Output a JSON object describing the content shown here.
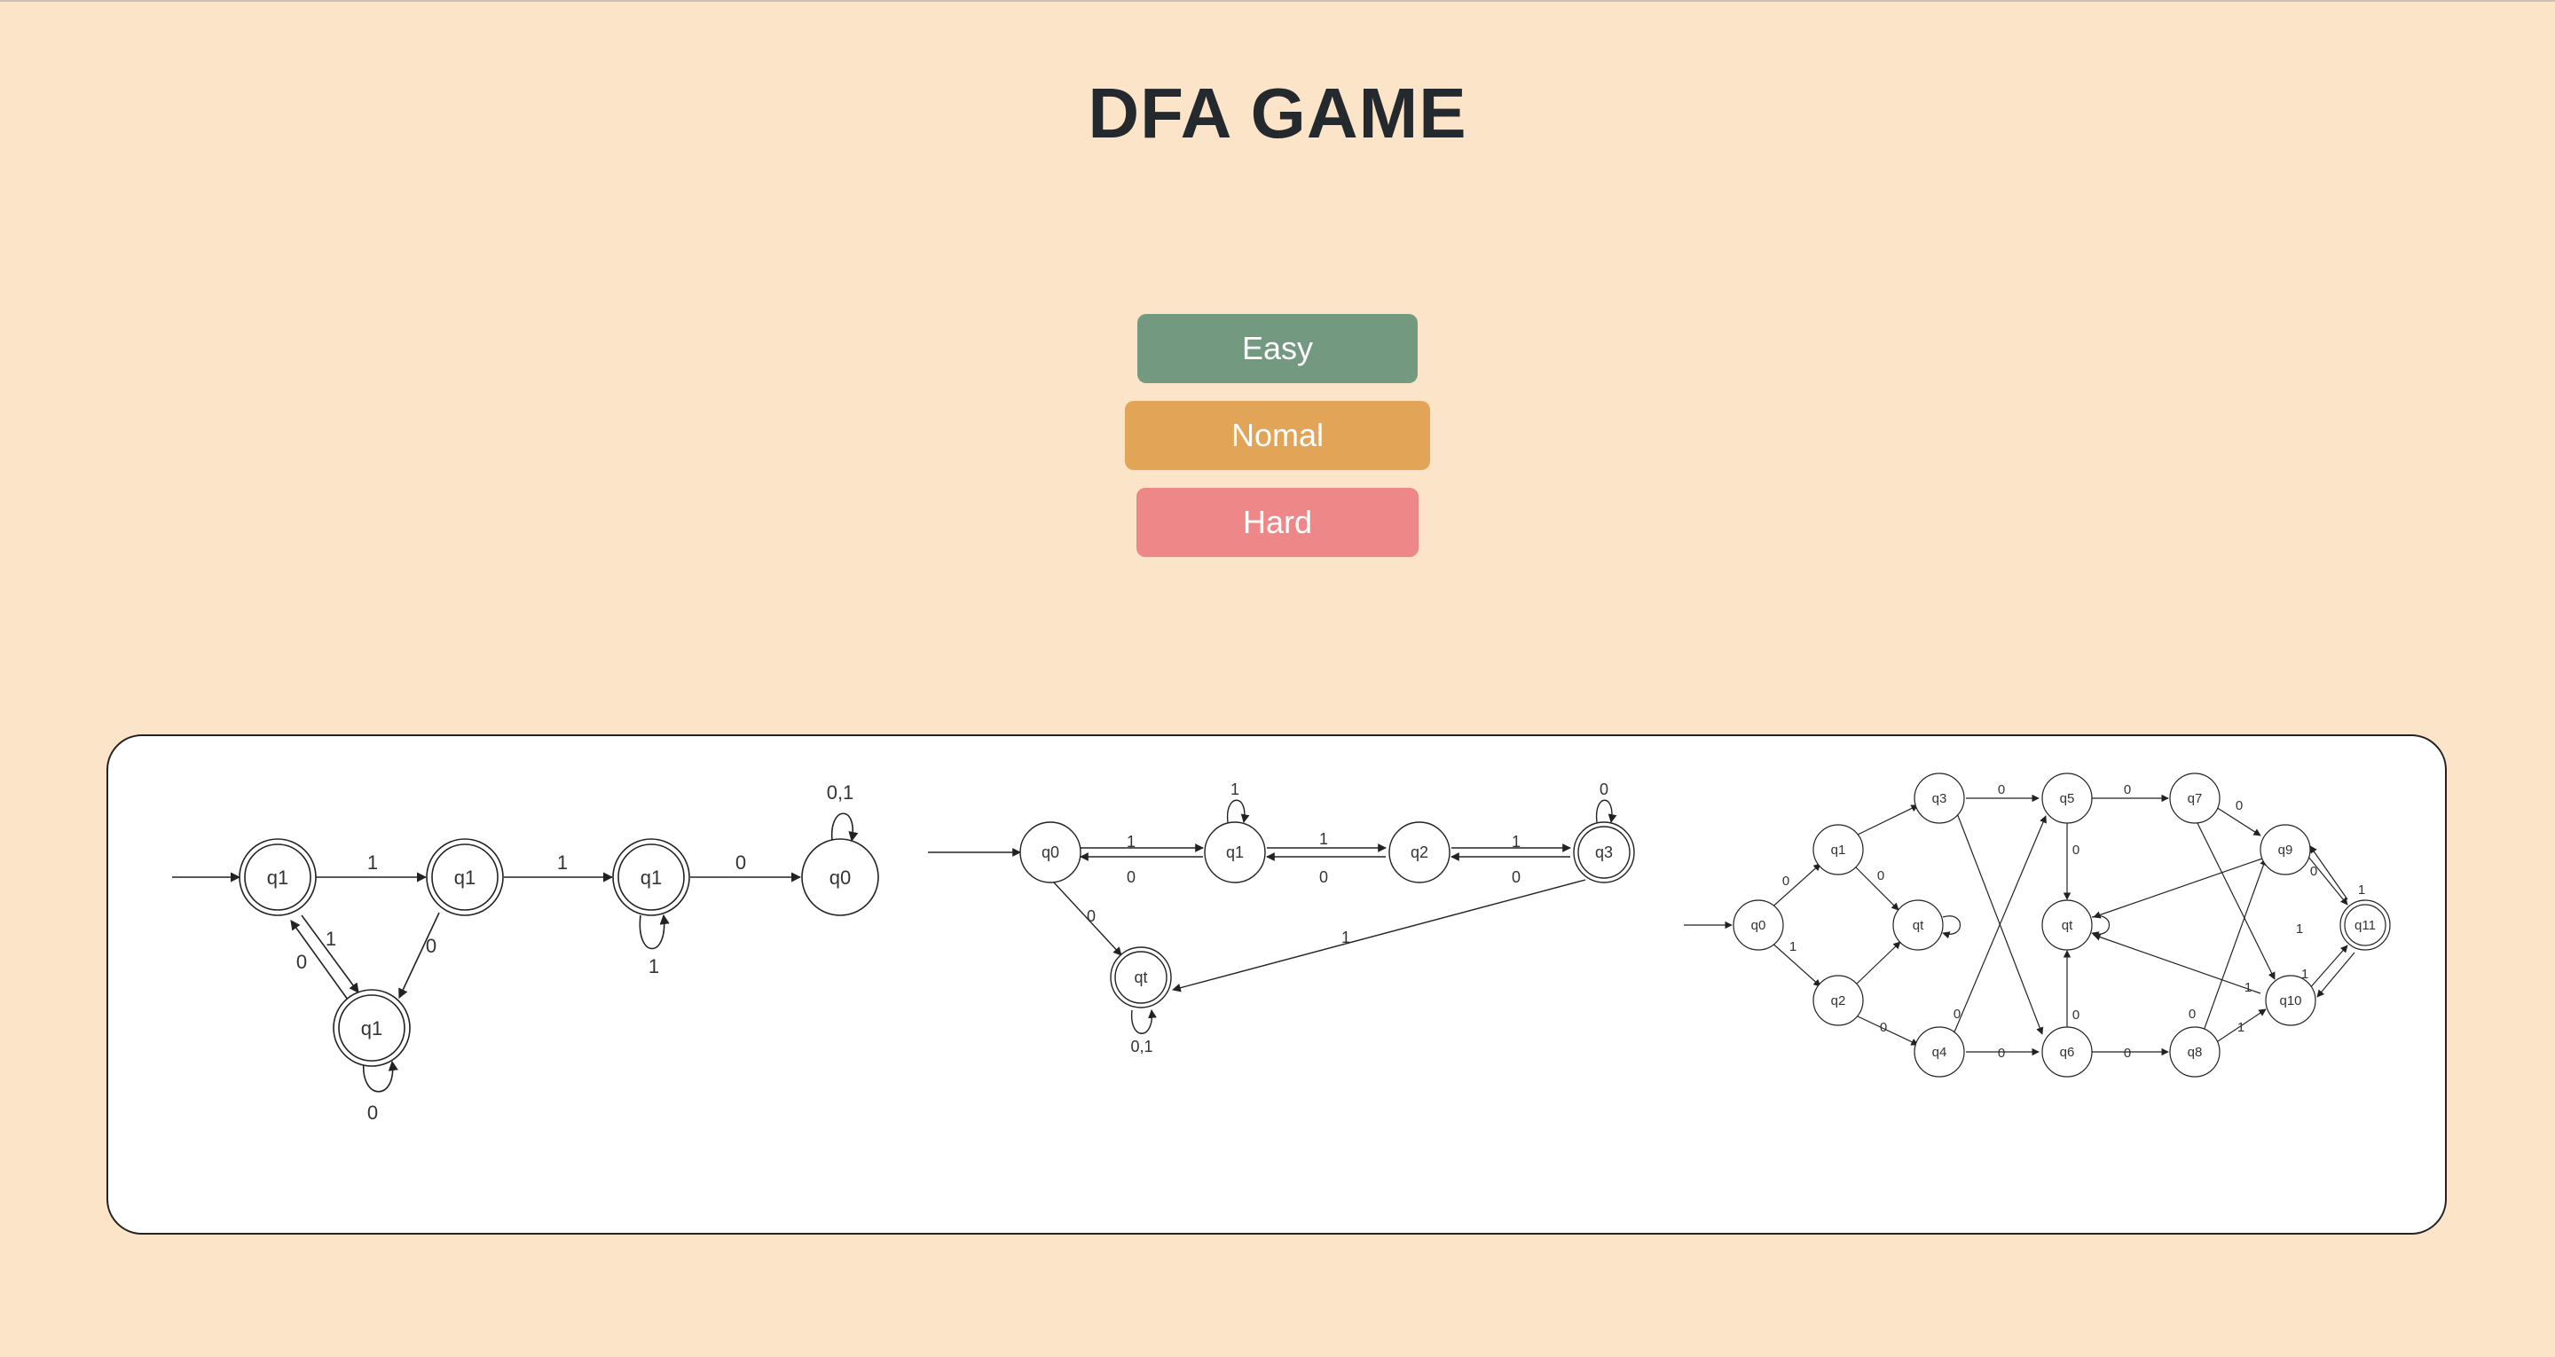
{
  "page": {
    "title": "DFA GAME",
    "background": "#fbe4c8"
  },
  "difficulty": {
    "easy": {
      "label": "Easy",
      "color": "#739a80"
    },
    "normal": {
      "label": "Nomal",
      "color": "#e2a456"
    },
    "hard": {
      "label": "Hard",
      "color": "#ee8888"
    }
  },
  "diagrams": {
    "easy": {
      "states": [
        "q1",
        "q1",
        "q1",
        "q1",
        "q0"
      ],
      "edge_labels": [
        "1",
        "1",
        "0",
        "1",
        "0",
        "0",
        "1",
        "0",
        "0,1"
      ]
    },
    "normal": {
      "states": [
        "q0",
        "q1",
        "q2",
        "q3",
        "qt"
      ],
      "edge_labels": [
        "1",
        "0",
        "1",
        "0",
        "1",
        "0",
        "1",
        "0",
        "0",
        "1",
        "0,1"
      ]
    },
    "hard": {
      "states": [
        "q0",
        "q1",
        "q2",
        "q3",
        "qt",
        "q4",
        "q5",
        "qt",
        "q6",
        "q7",
        "q8",
        "q9",
        "q10",
        "q11"
      ],
      "edge_labels": [
        "0",
        "1",
        "0",
        "0",
        "0",
        "0",
        "0",
        "0",
        "0",
        "0",
        "0",
        "0",
        "1",
        "1",
        "1",
        "1",
        "0",
        "0",
        "1"
      ]
    }
  }
}
